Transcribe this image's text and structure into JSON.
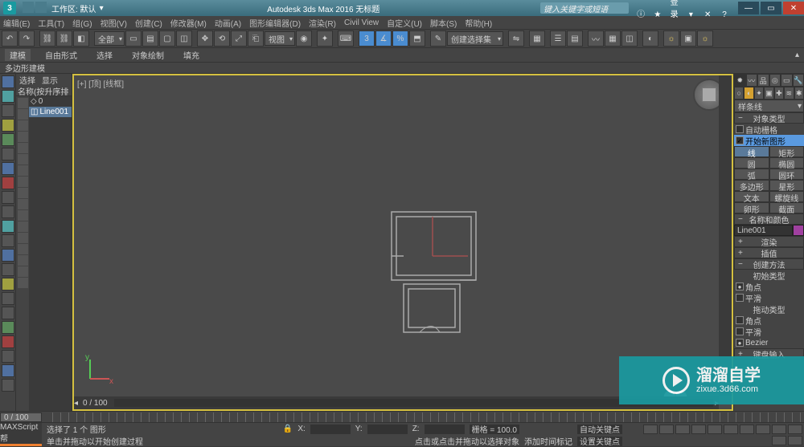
{
  "titlebar": {
    "workspace_label": "工作区: 默认",
    "title": "Autodesk 3ds Max 2016   无标题",
    "search_placeholder": "键入关键字或短语",
    "login": "登录"
  },
  "menu": [
    "编辑(E)",
    "工具(T)",
    "组(G)",
    "视图(V)",
    "创建(C)",
    "修改器(M)",
    "动画(A)",
    "图形编辑器(D)",
    "渲染(R)",
    "Civil View",
    "自定义(U)",
    "脚本(S)",
    "帮助(H)"
  ],
  "ribbon": {
    "tabs": [
      "建模",
      "自由形式",
      "选择",
      "对象绘制",
      "填充"
    ],
    "active": 0
  },
  "subbar": "多边形建模",
  "toolbar": {
    "dropdown1": "全部",
    "dropdown2": "视图",
    "dropdown3": "创建选择集"
  },
  "explorer": {
    "tabs": [
      "选择",
      "显示"
    ],
    "header": "名称(按升序排序)",
    "items": [
      {
        "label": "0",
        "selected": false
      },
      {
        "label": "Line001",
        "selected": true
      }
    ]
  },
  "viewport": {
    "label": "[+] [顶] [线框]",
    "hscroll_label": "0 / 100"
  },
  "cmdpanel": {
    "dropdown": "样条线",
    "roll_objtype": "对象类型",
    "autogrid": "自动栅格",
    "start_new": "开始新图形",
    "grid": [
      [
        "线",
        "矩形"
      ],
      [
        "圆",
        "椭圆"
      ],
      [
        "弧",
        "圆环"
      ],
      [
        "多边形",
        "星形"
      ],
      [
        "文本",
        "螺旋线"
      ],
      [
        "卵形",
        "截面"
      ]
    ],
    "roll_namecol": "名称和颜色",
    "name_value": "Line001",
    "roll_render": "渲染",
    "roll_interp": "插值",
    "roll_create": "创建方法",
    "sec_initial": "初始类型",
    "opt_corner": "角点",
    "opt_smooth": "平滑",
    "sec_drag": "拖动类型",
    "opt_bezier": "Bezier",
    "roll_keyboard": "键盘输入"
  },
  "timeline": {
    "pos": "0 / 100"
  },
  "status": {
    "line1": "选择了 1 个 图形",
    "line2": "单击并拖动以开始创建过程",
    "script": "MAXScript  帮",
    "lock": "🔒",
    "x": "X:",
    "xv": "",
    "y": "Y:",
    "yv": "",
    "z": "Z:",
    "zv": "",
    "grid": "栅格 = 100.0",
    "autokey": "自动关键点",
    "setkey": "设置关键点",
    "hint2": "点击或点击并拖动以选择对象",
    "addtime": "添加时间标记"
  },
  "watermark": {
    "big": "溜溜自学",
    "small": "zixue.3d66.com"
  }
}
